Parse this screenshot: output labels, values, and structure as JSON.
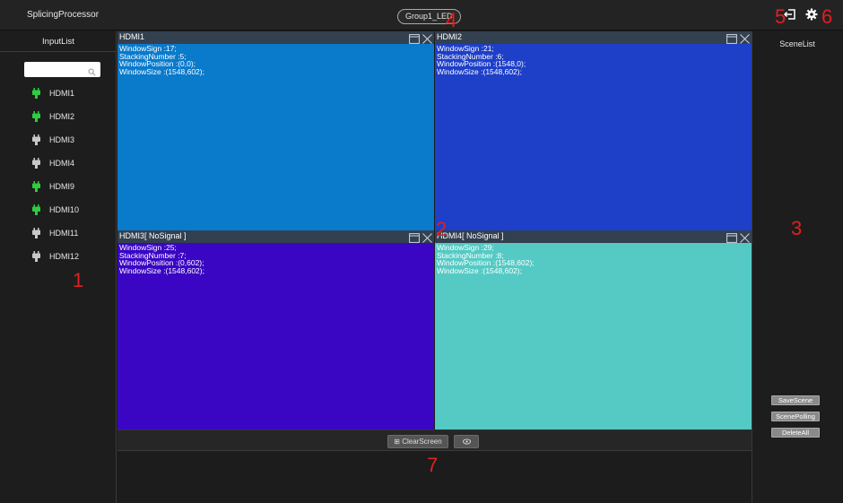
{
  "app": {
    "title": "SplicingProcessor",
    "group": "Group1_LED"
  },
  "left_panel": {
    "title": "InputList",
    "search": {
      "value": "",
      "placeholder": ""
    },
    "inputs": [
      {
        "label": "HDMI1",
        "color": "#2ecc40"
      },
      {
        "label": "HDMI2",
        "color": "#2ecc40"
      },
      {
        "label": "HDMI3",
        "color": "#c8c8c8"
      },
      {
        "label": "HDMI4",
        "color": "#c8c8c8"
      },
      {
        "label": "HDMI9",
        "color": "#2ecc40"
      },
      {
        "label": "HDMI10",
        "color": "#2ecc40"
      },
      {
        "label": "HDMI11",
        "color": "#c8c8c8"
      },
      {
        "label": "HDMI12",
        "color": "#c8c8c8"
      }
    ]
  },
  "windows": [
    {
      "title": "HDMI1",
      "color": "#0a7acb",
      "sign": "WindowSign :17;",
      "stack": "StackingNumber :5;",
      "position": "WindowPosition :(0,0);",
      "size": "WindowSize :(1548,602);"
    },
    {
      "title": "HDMI2",
      "color": "#1e3fc8",
      "sign": "WindowSign :21;",
      "stack": "StackingNumber :6;",
      "position": "WindowPosition :(1548,0);",
      "size": "WindowSize :(1548,602);"
    },
    {
      "title": "HDMI3[ NoSignal ]",
      "color": "#3a06c4",
      "sign": "WindowSign :25;",
      "stack": "StackingNumber :7;",
      "position": "WindowPosition :(0,602);",
      "size": "WindowSize :(1548,602);"
    },
    {
      "title": "HDMI4[ NoSignal ]",
      "color": "#55cac4",
      "sign": "WindowSign :29;",
      "stack": "StackingNumber :8;",
      "position": "WindowPosition :(1548,602);",
      "size": "WindowSize :(1548,602);"
    }
  ],
  "toolbar": {
    "clear_label": "⊞ ClearScreen"
  },
  "right_panel": {
    "title": "SceneList",
    "buttons": [
      "SaveScene",
      "ScenePolling",
      "DeleteAll"
    ]
  },
  "annotations": [
    "1",
    "2",
    "3",
    "4",
    "5",
    "6",
    "7"
  ],
  "icons": {
    "logout": "logout-icon",
    "settings": "gear-icon",
    "eye": "eye-icon",
    "search": "search-icon",
    "maximize": "maximize-icon",
    "close": "close-icon",
    "plug": "plug-icon"
  }
}
